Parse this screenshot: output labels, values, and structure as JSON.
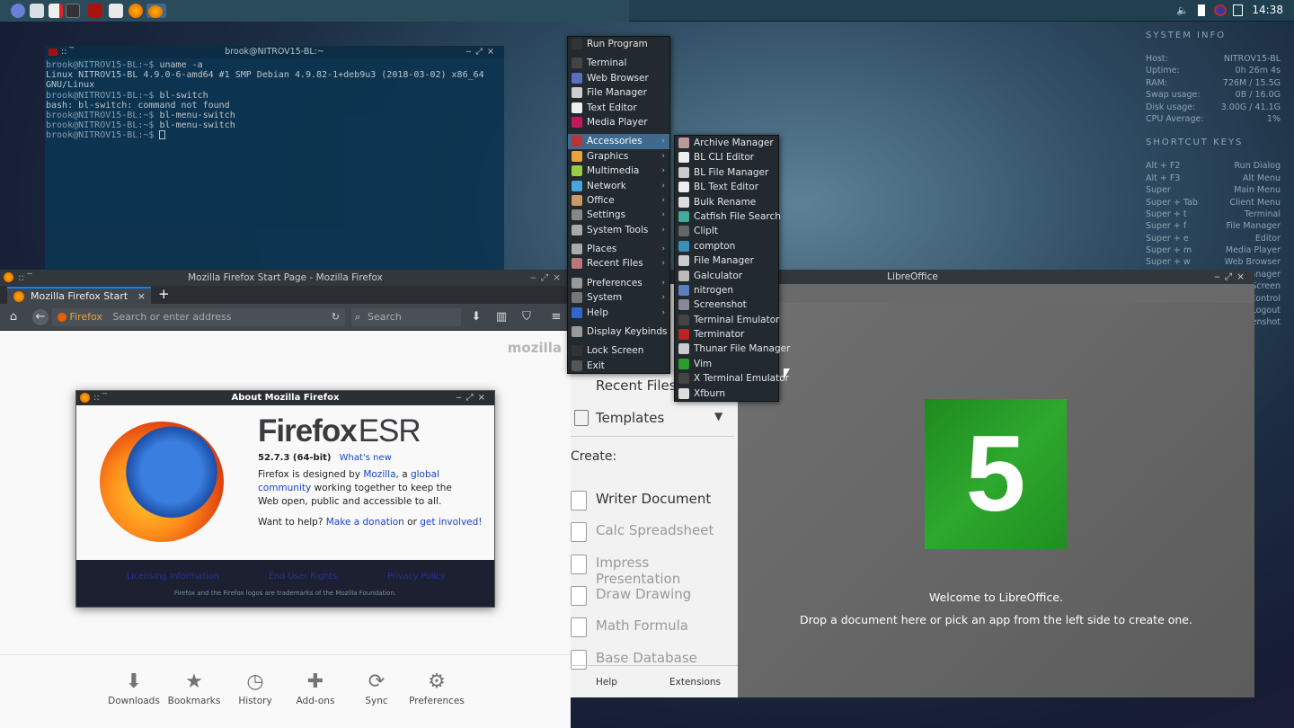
{
  "taskbar": {
    "clock": "14:38"
  },
  "conky": {
    "sysinfo_title": "SYSTEM INFO",
    "sysinfo": [
      [
        "Host:",
        "NITROV15-BL"
      ],
      [
        "Uptime:",
        "0h 26m 4s"
      ],
      [
        "RAM:",
        "726M / 15.5G"
      ],
      [
        "Swap usage:",
        "0B / 16.0G"
      ],
      [
        "Disk usage:",
        "3.00G / 41.1G"
      ],
      [
        "CPU Average:",
        "1%"
      ]
    ],
    "shortcuts_title": "SHORTCUT KEYS",
    "shortcuts": [
      [
        "Alt + F2",
        "Run Dialog"
      ],
      [
        "Alt + F3",
        "Alt Menu"
      ],
      [
        "Super",
        "Main Menu"
      ],
      [
        "Super + Tab",
        "Client Menu"
      ],
      [
        "Super + t",
        "Terminal"
      ],
      [
        "Super + f",
        "File Manager"
      ],
      [
        "Super + e",
        "Editor"
      ],
      [
        "Super + m",
        "Media Player"
      ],
      [
        "Super + w",
        "Web Browser"
      ],
      [
        "",
        "anager"
      ],
      [
        "",
        "Screen"
      ],
      [
        "",
        "Control"
      ],
      [
        "",
        "Logout"
      ],
      [
        "",
        "Screenshot"
      ]
    ]
  },
  "terminal": {
    "title": "brook@NITROV15-BL:~",
    "prompt": "brook@NITROV15-BL:~$",
    "lines": [
      {
        "cmd": " uname -a"
      },
      {
        "out": "Linux NITROV15-BL 4.9.0-6-amd64 #1 SMP Debian 4.9.82-1+deb9u3 (2018-03-02) x86_64 GNU/Linux"
      },
      {
        "cmd": " bl-switch"
      },
      {
        "out": "bash: bl-switch: command not found"
      },
      {
        "cmd": " bl-menu-switch"
      },
      {
        "cmd": " bl-menu-switch"
      },
      {
        "cmd": " "
      }
    ]
  },
  "firefox": {
    "title": "Mozilla Firefox Start Page - Mozilla Firefox",
    "tab_label": "Mozilla Firefox Start Page",
    "identity": "Firefox",
    "url_placeholder": "Search or enter address",
    "search_placeholder": "Search",
    "mozilla_brand": "mozilla",
    "bottom": [
      {
        "label": "Downloads",
        "icon": "⬇"
      },
      {
        "label": "Bookmarks",
        "icon": "★"
      },
      {
        "label": "History",
        "icon": "◷"
      },
      {
        "label": "Add-ons",
        "icon": "✚"
      },
      {
        "label": "Sync",
        "icon": "⟳"
      },
      {
        "label": "Preferences",
        "icon": "⚙"
      }
    ]
  },
  "about": {
    "title": "About Mozilla Firefox",
    "brand1": "Firefox",
    "brand2": "ESR",
    "version": "52.7.3 (64-bit)",
    "whats_new": "What's new",
    "p1_a": "Firefox is designed by ",
    "p1_link1": "Mozilla",
    "p1_b": ", a ",
    "p1_link2": "global community",
    "p1_c": " working together to keep the Web open, public and accessible to all.",
    "p2_a": "Want to help? ",
    "p2_link1": "Make a donation",
    "p2_b": " or ",
    "p2_link2": "get involved!",
    "foot_links": [
      "Licensing Information",
      "End-User Rights",
      "Privacy Policy"
    ],
    "trademark": "Firefox and the Firefox logos are trademarks of the Mozilla Foundation."
  },
  "libreoffice": {
    "title": "LibreOffice",
    "recent_files": "Recent Files",
    "templates": "Templates",
    "create": "Create:",
    "apps": [
      "Writer Document",
      "Calc Spreadsheet",
      "Impress Presentation",
      "Draw Drawing",
      "Math Formula",
      "Base Database"
    ],
    "help": "Help",
    "extensions": "Extensions",
    "logo_number": "5",
    "welcome1": "Welcome to LibreOffice.",
    "welcome2": "Drop a document here or pick an app from the left side to create one."
  },
  "menu": {
    "items": [
      {
        "label": "Run Program",
        "icon": "#333"
      },
      {
        "sep": true
      },
      {
        "label": "Terminal",
        "icon": "#444"
      },
      {
        "label": "Web Browser",
        "icon": "#5a6fc0"
      },
      {
        "label": "File Manager",
        "icon": "#ccc"
      },
      {
        "label": "Text Editor",
        "icon": "#eee"
      },
      {
        "label": "Media Player",
        "icon": "#c2185b"
      },
      {
        "sep": true
      },
      {
        "label": "Accessories",
        "icon": "#b33",
        "sub": true,
        "hl": true
      },
      {
        "label": "Graphics",
        "icon": "#e8a33b",
        "sub": true
      },
      {
        "label": "Multimedia",
        "icon": "#9c4",
        "sub": true
      },
      {
        "label": "Network",
        "icon": "#4aa3df",
        "sub": true
      },
      {
        "label": "Office",
        "icon": "#c96",
        "sub": true
      },
      {
        "label": "Settings",
        "icon": "#888",
        "sub": true
      },
      {
        "label": "System Tools",
        "icon": "#aaa",
        "sub": true
      },
      {
        "sep": true
      },
      {
        "label": "Places",
        "icon": "#aaa",
        "sub": true
      },
      {
        "label": "Recent Files",
        "icon": "#b77",
        "sub": true
      },
      {
        "sep": true
      },
      {
        "label": "Preferences",
        "icon": "#999",
        "sub": true
      },
      {
        "label": "System",
        "icon": "#777",
        "sub": true
      },
      {
        "label": "Help",
        "icon": "#36c",
        "sub": true
      },
      {
        "sep": true
      },
      {
        "label": "Display Keybinds",
        "icon": "#999",
        "sub": true
      },
      {
        "sep": true
      },
      {
        "label": "Lock Screen",
        "icon": "#333"
      },
      {
        "label": "Exit",
        "icon": "#555"
      }
    ],
    "accessories": [
      {
        "label": "Archive Manager",
        "icon": "#b99"
      },
      {
        "label": "BL CLI Editor",
        "icon": "#eee"
      },
      {
        "label": "BL File Manager",
        "icon": "#ccc"
      },
      {
        "label": "BL Text Editor",
        "icon": "#eee"
      },
      {
        "label": "Bulk Rename",
        "icon": "#ddd"
      },
      {
        "label": "Catfish File Search",
        "icon": "#4a9"
      },
      {
        "label": "ClipIt",
        "icon": "#666"
      },
      {
        "label": "compton",
        "icon": "#3a8fb7"
      },
      {
        "label": "File Manager",
        "icon": "#ccc"
      },
      {
        "label": "Galculator",
        "icon": "#bbb"
      },
      {
        "label": "nitrogen",
        "icon": "#5a7fc0"
      },
      {
        "label": "Screenshot",
        "icon": "#889"
      },
      {
        "label": "Terminal Emulator",
        "icon": "#444"
      },
      {
        "label": "Terminator",
        "icon": "#b22"
      },
      {
        "label": "Thunar File Manager",
        "icon": "#ccc"
      },
      {
        "label": "Vim",
        "icon": "#2a9d2a"
      },
      {
        "label": "X Terminal Emulator",
        "icon": "#444"
      },
      {
        "label": "Xfburn",
        "icon": "#ddd"
      }
    ]
  },
  "colors": {
    "accent": "#0a84ff",
    "menu_highlight": "#3e6a90",
    "lo_green": "#2ea82e"
  }
}
